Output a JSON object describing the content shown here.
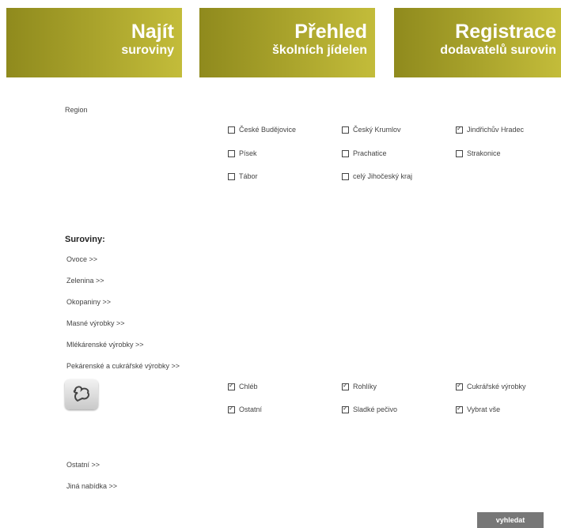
{
  "tabs": [
    {
      "title": "Najít",
      "subtitle": "suroviny"
    },
    {
      "title": "Přehled",
      "subtitle": "školních jídelen"
    },
    {
      "title": "Registrace",
      "subtitle": "dodavatelů surovin"
    }
  ],
  "region": {
    "label": "Region",
    "options": [
      {
        "label": "České Budějovice",
        "checked": false
      },
      {
        "label": "Český Krumlov",
        "checked": false
      },
      {
        "label": "Jindřichův Hradec",
        "checked": true
      },
      {
        "label": "Písek",
        "checked": false
      },
      {
        "label": "Prachatice",
        "checked": false
      },
      {
        "label": "Strakonice",
        "checked": false
      },
      {
        "label": "Tábor",
        "checked": false
      },
      {
        "label": "celý Jihočeský kraj",
        "checked": false
      }
    ]
  },
  "suroviny": {
    "title": "Suroviny:",
    "categories": [
      "Ovoce >>",
      "Zelenina >>",
      "Okopaniny >>",
      "Masné výrobky >>",
      "Mlékárenské výrobky >>",
      "Pekárenské a cukrářské výrobky >>"
    ],
    "bakery_options": [
      {
        "label": "Chléb",
        "checked": true
      },
      {
        "label": "Rohlíky",
        "checked": true
      },
      {
        "label": "Cukrářské výrobky",
        "checked": true
      },
      {
        "label": "Ostatní",
        "checked": true
      },
      {
        "label": "Sladké pečivo",
        "checked": true
      },
      {
        "label": "Vybrat vše",
        "checked": true
      }
    ]
  },
  "other_links": [
    "Ostatní >>",
    "Jiná nabídka >>"
  ],
  "search_button": "vyhledat",
  "colors": {
    "tab_dark": "#8f8a1d",
    "tab_light": "#c3bc3a",
    "button": "#777777"
  }
}
